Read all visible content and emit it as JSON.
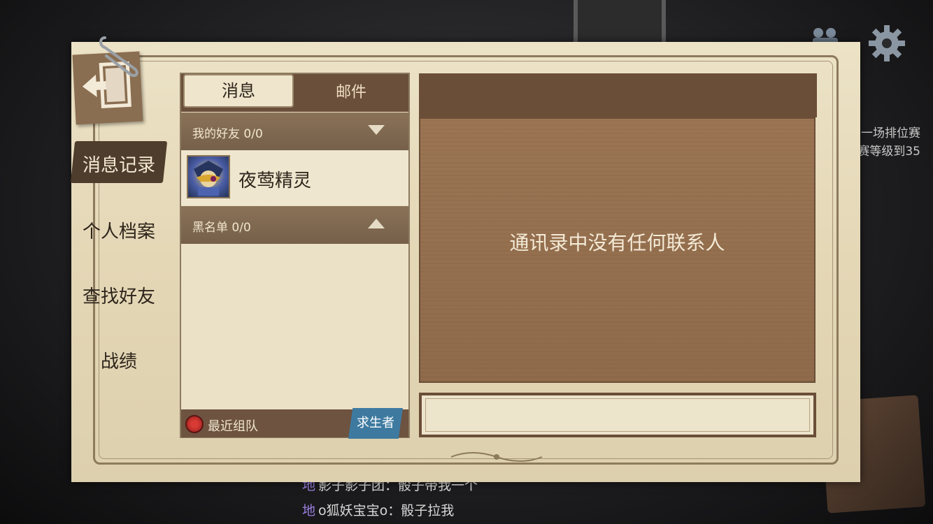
{
  "background": {
    "side_text": [
      "一场排位赛",
      "赛等级到35"
    ],
    "chat": [
      {
        "tag": "地",
        "text": "影子影子团：骰子带我一个"
      },
      {
        "tag": "地",
        "text": "o狐妖宝宝o：骰子拉我"
      }
    ]
  },
  "nav": {
    "items": [
      {
        "label": "消息记录"
      },
      {
        "label": "个人档案"
      },
      {
        "label": "查找好友"
      },
      {
        "label": "战绩"
      }
    ]
  },
  "tabs": {
    "messages": "消息",
    "mail": "邮件"
  },
  "friends_group": {
    "label": "我的好友 0/0"
  },
  "friend": {
    "name": "夜莺精灵"
  },
  "blacklist_group": {
    "label": "黑名单 0/0"
  },
  "bottom": {
    "recent_team": "最近组队",
    "survivor": "求生者"
  },
  "content": {
    "empty_message": "通讯录中没有任何联系人"
  },
  "colors": {
    "paper": "#e6dab9",
    "dark_brown": "#6b4e37",
    "panel_brown": "#96704f",
    "survivor_blue": "#3e7aa0"
  }
}
